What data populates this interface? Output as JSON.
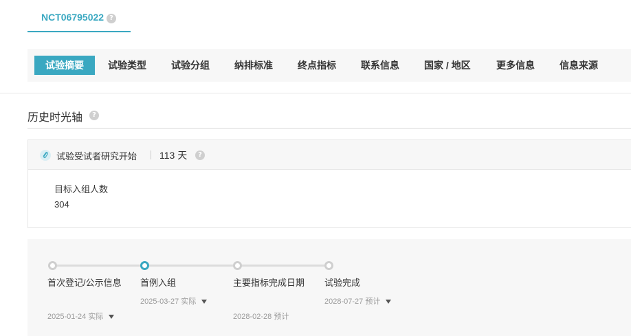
{
  "trial_tab": {
    "id": "NCT06795022"
  },
  "nav": {
    "items": [
      "试验摘要",
      "试验类型",
      "试验分组",
      "纳排标准",
      "终点指标",
      "联系信息",
      "国家 / 地区",
      "更多信息",
      "信息来源"
    ],
    "active_index": 0
  },
  "section": {
    "title": "历史时光轴"
  },
  "card": {
    "event_label": "试验受试者研究开始",
    "days": "113 天",
    "metric_label": "目标入组人数",
    "metric_value": "304"
  },
  "timeline": {
    "milestones": [
      {
        "title": "首次登记/公示信息",
        "date": "2025-01-24 实际",
        "active": false
      },
      {
        "title": "首例入组",
        "date": "2025-03-27 实际",
        "active": true
      },
      {
        "title": "主要指标完成日期",
        "date": "2028-02-28 预计",
        "active": false
      },
      {
        "title": "试验完成",
        "date": "2028-07-27 预计",
        "active": false
      }
    ]
  },
  "colors": {
    "accent": "#3aa8c1",
    "nav_bg": "#f7f7f7",
    "muted_text": "#999999"
  }
}
